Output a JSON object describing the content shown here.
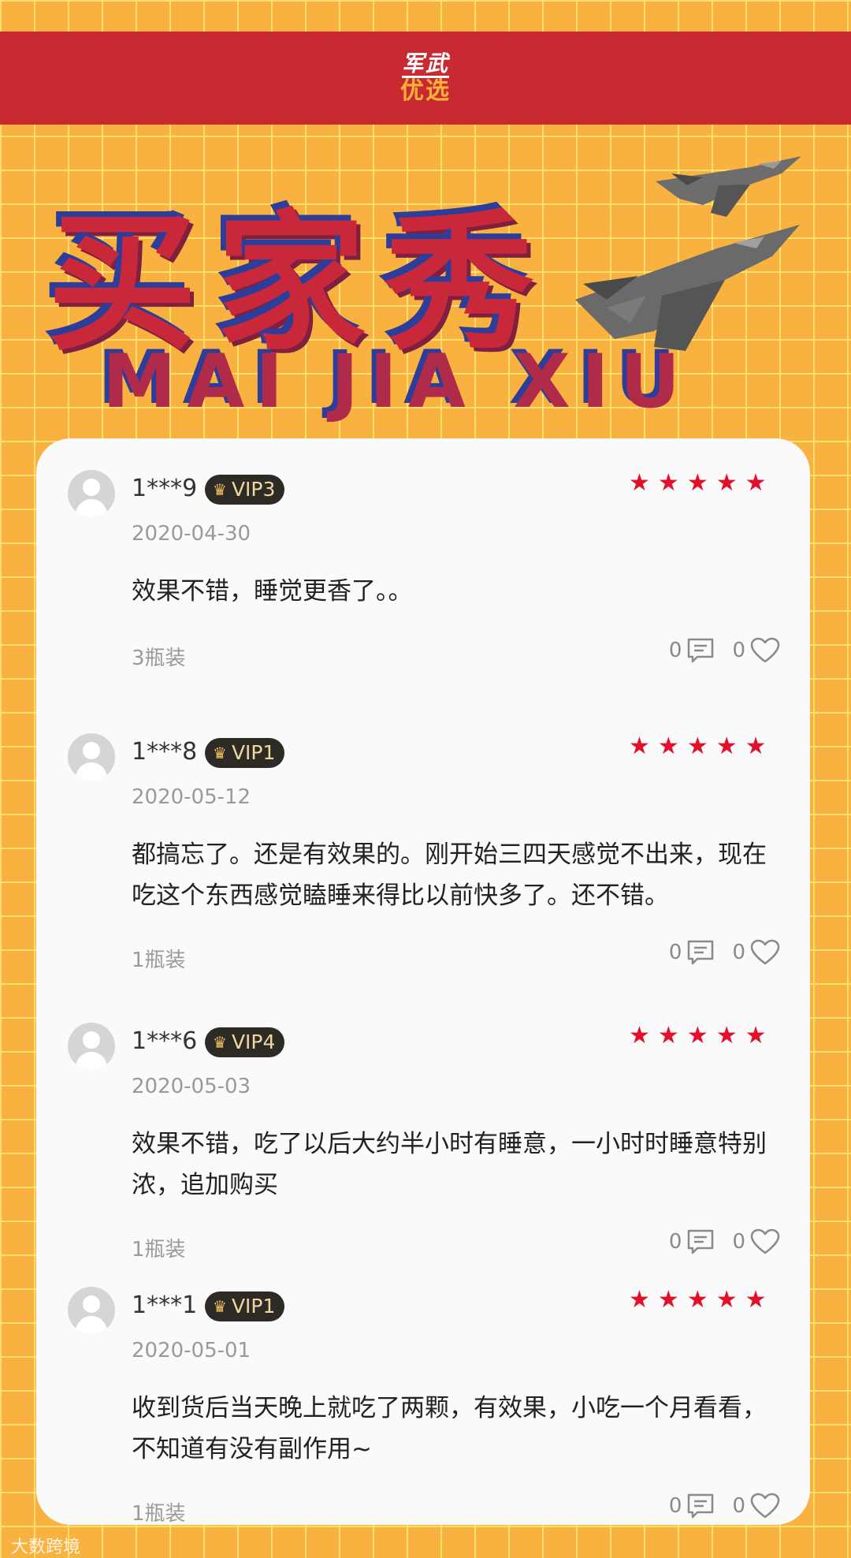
{
  "brand": {
    "top": "军武",
    "bottom": "优选"
  },
  "hero": {
    "title": "买家秀",
    "subtitle": "MAI JIA XIU"
  },
  "reviews": [
    {
      "user": "1***9",
      "vip": "VIP3",
      "rating": 5,
      "date": "2020-04-30",
      "content": "效果不错，睡觉更香了。。",
      "spec": "3瓶装",
      "comments": "0",
      "likes": "0"
    },
    {
      "user": "1***8",
      "vip": "VIP1",
      "rating": 5,
      "date": "2020-05-12",
      "content": "都搞忘了。还是有效果的。刚开始三四天感觉不出来，现在吃这个东西感觉瞌睡来得比以前快多了。还不错。",
      "spec": "1瓶装",
      "comments": "0",
      "likes": "0"
    },
    {
      "user": "1***6",
      "vip": "VIP4",
      "rating": 5,
      "date": "2020-05-03",
      "content": "效果不错，吃了以后大约半小时有睡意，一小时时睡意特别浓，追加购买",
      "spec": "1瓶装",
      "comments": "0",
      "likes": "0"
    },
    {
      "user": "1***1",
      "vip": "VIP1",
      "rating": 5,
      "date": "2020-05-01",
      "content": "收到货后当天晚上就吃了两颗，有效果，小吃一个月看看，不知道有没有副作用~",
      "spec": "1瓶装",
      "comments": "0",
      "likes": "0"
    }
  ],
  "watermark": "大数跨境",
  "colors": {
    "banner": "#c92a32",
    "background": "#f9b23f",
    "star": "#e2102a",
    "vip_badge": "#2e2a26"
  }
}
